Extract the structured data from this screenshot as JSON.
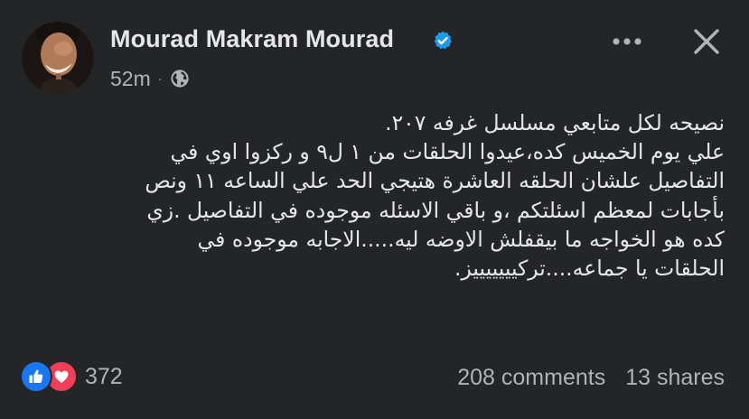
{
  "author": {
    "name": "Mourad Makram Mourad",
    "verified": true,
    "avatar_icon": "profile-photo"
  },
  "meta": {
    "time": "52m",
    "separator": "·",
    "audience_icon": "globe-icon"
  },
  "header_actions": {
    "more_icon": "more-horizontal-icon",
    "close_icon": "close-icon"
  },
  "post": {
    "lines": [
      "نصيحه لكل متابعي مسلسل غرفه ٢٠٧.",
      "علي يوم الخميس كده،عيدوا الحلقات من ١ ل٩ و ركزوا اوي في",
      "التفاصيل علشان الحلقه العاشرة هتيجي الحد علي الساعه ١١ ونص",
      "بأجابات لمعظم اسئلتكم ،و باقي الاسئله موجوده في التفاصيل .زي",
      "كده هو الخواجه ما بيقفلش الاوضه ليه.....الاجابه موجوده في",
      "الحلقات يا جماعه....تركيييييييز."
    ]
  },
  "footer": {
    "reaction_icons": [
      "like-icon",
      "love-icon"
    ],
    "reaction_count": "372",
    "comments": "208 comments",
    "shares": "13 shares"
  },
  "colors": {
    "background": "#242526",
    "text_primary": "#e4e6eb",
    "text_secondary": "#b0b3b8",
    "verified_blue": "#1d9bf0",
    "like_blue": "#1877f2",
    "love_red": "#f33e58"
  }
}
